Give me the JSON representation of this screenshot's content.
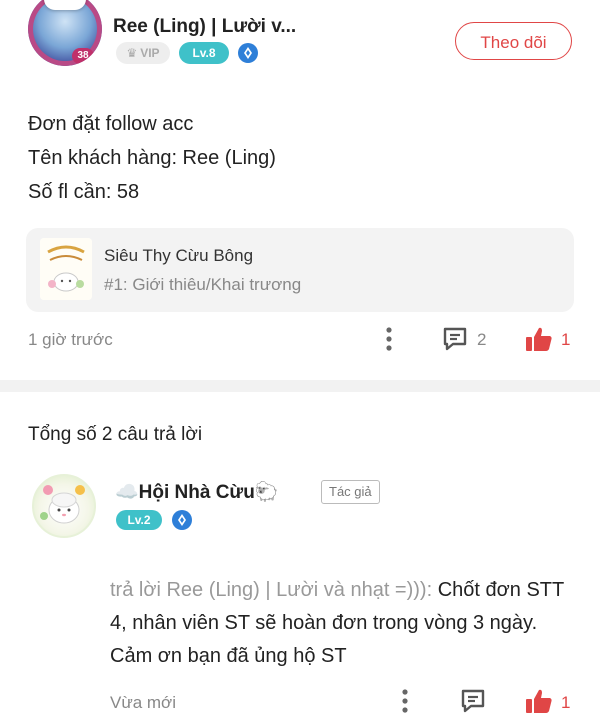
{
  "post": {
    "author_name": "Ree (Ling) | Lười v...",
    "vip_label": "VIP",
    "level_label": "Lv.8",
    "avatar_badge": "38",
    "follow_label": "Theo dõi",
    "content_lines": [
      "Đơn đặt follow acc",
      "Tên khách hàng: Ree (Ling)",
      "Số fl cần: 58"
    ],
    "linked_card": {
      "title": "Siêu Thy Cừu Bông",
      "subtitle": "#1: Giới thiêu/Khai trương"
    },
    "time": "1 giờ trước",
    "comment_count": "2",
    "like_count": "1"
  },
  "replies": {
    "total_label": "Tổng số 2 câu trả lời",
    "items": [
      {
        "author_name": "☁️Hội Nhà Cừu🐑",
        "author_tag": "Tác giả",
        "level_label": "Lv.2",
        "quote": "trả lời Ree (Ling) | Lười và nhạt =))):",
        "text": "Chốt đơn STT 4, nhân viên ST sẽ hoàn đơn trong vòng 3 ngày. Cảm ơn bạn đã ủng hộ ST",
        "time": "Vừa mới",
        "like_count": "1"
      }
    ]
  },
  "colors": {
    "accent_red": "#e04646",
    "level_teal": "#3fc1c9",
    "diamond_blue": "#2e7fd8"
  }
}
